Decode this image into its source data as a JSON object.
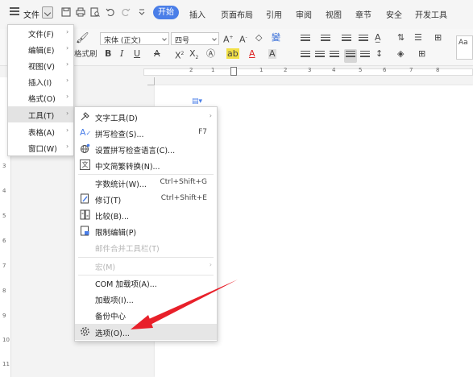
{
  "menubar": {
    "file_label": "文件",
    "active_tab": "开始",
    "tabs": [
      "插入",
      "页面布局",
      "引用",
      "审阅",
      "视图",
      "章节",
      "安全",
      "开发工具"
    ]
  },
  "ribbon": {
    "font_name": "宋体 (正文)",
    "font_size": "四号",
    "format_painter_label": "格式刷",
    "styles_partial": "Aa"
  },
  "ruler": {
    "h_ticks": [
      "2",
      "1",
      "1",
      "2",
      "3",
      "4",
      "5",
      "6",
      "7",
      "8"
    ],
    "v_ticks": [
      "3",
      "4",
      "5",
      "6",
      "7",
      "8",
      "9",
      "10",
      "11"
    ]
  },
  "main_menu": [
    {
      "label": "文件(F)",
      "has_submenu": true
    },
    {
      "label": "编辑(E)",
      "has_submenu": true
    },
    {
      "label": "视图(V)",
      "has_submenu": true
    },
    {
      "label": "插入(I)",
      "has_submenu": true
    },
    {
      "label": "格式(O)",
      "has_submenu": true
    },
    {
      "label": "工具(T)",
      "has_submenu": true,
      "active": true
    },
    {
      "label": "表格(A)",
      "has_submenu": true
    },
    {
      "label": "窗口(W)",
      "has_submenu": true
    }
  ],
  "tools_menu": [
    {
      "label": "文字工具(D)",
      "icon": "text-tools-icon",
      "has_submenu": true
    },
    {
      "label": "拼写检查(S)...",
      "icon": "spell-check-icon",
      "shortcut": "F7"
    },
    {
      "label": "设置拼写检查语言(C)...",
      "icon": "language-icon"
    },
    {
      "label": "中文简繁转换(N)...",
      "icon": "convert-icon"
    },
    {
      "label": "字数统计(W)...",
      "shortcut": "Ctrl+Shift+G"
    },
    {
      "label": "修订(T)",
      "icon": "track-changes-icon",
      "shortcut": "Ctrl+Shift+E"
    },
    {
      "label": "比较(B)...",
      "icon": "compare-icon"
    },
    {
      "label": "限制编辑(P)",
      "icon": "restrict-edit-icon"
    },
    {
      "label": "邮件合并工具栏(T)",
      "disabled": true
    },
    {
      "label": "宏(M)",
      "disabled": true,
      "has_submenu": true
    },
    {
      "label": "COM 加载项(A)..."
    },
    {
      "label": "加载项(I)..."
    },
    {
      "label": "备份中心"
    },
    {
      "label": "选项(O)...",
      "icon": "gear-icon",
      "hovered": true
    }
  ],
  "colors": {
    "accent": "#4a7ee8",
    "annotation_arrow": "#e8202a",
    "highlight": "#f2e046",
    "font_color": "#dd2222"
  }
}
